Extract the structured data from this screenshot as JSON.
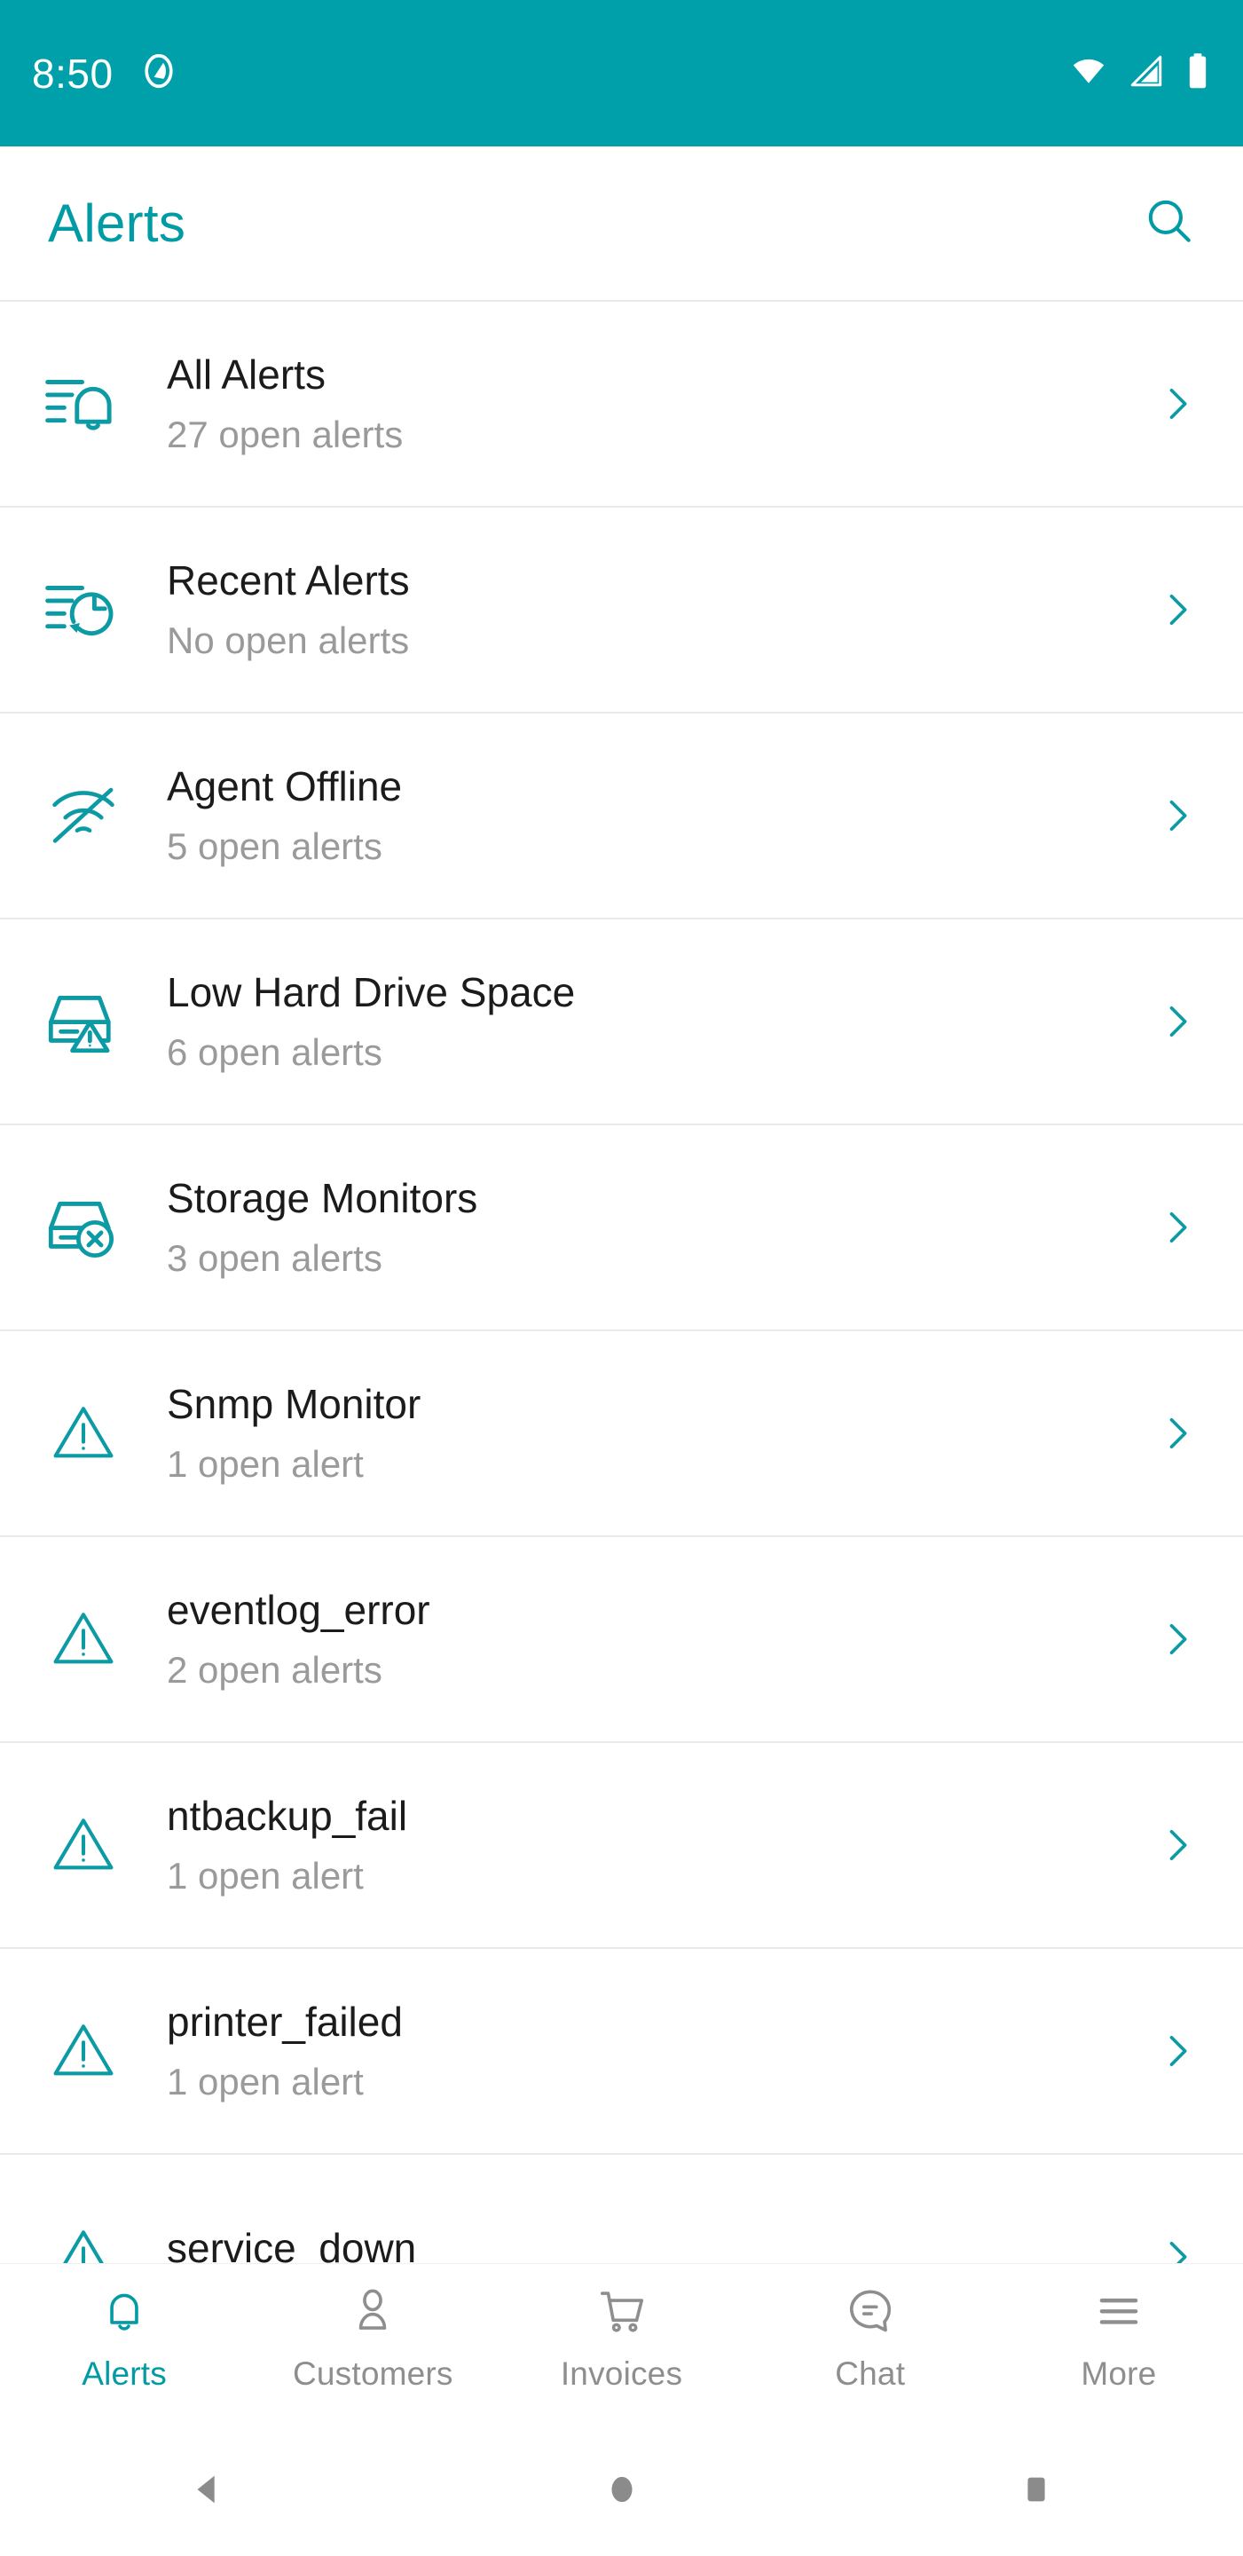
{
  "statusbar": {
    "time": "8:50",
    "icons": [
      "android-q-logo-icon",
      "wifi-icon",
      "cellular-signal-icon",
      "battery-icon"
    ]
  },
  "header": {
    "title": "Alerts",
    "search_icon": "search-icon"
  },
  "colors": {
    "accent": "#009BA5",
    "statusbar": "#00A0AA",
    "title": "#1b1b1b",
    "subtitle": "#9a9a9a",
    "divider": "#eaeaea",
    "inactive_tab": "#8e8e8e"
  },
  "list": {
    "items": [
      {
        "title": "All Alerts",
        "subtitle": "27 open alerts",
        "icon": "alert-list-bell-icon",
        "chevron": "chevron-right-icon"
      },
      {
        "title": "Recent Alerts",
        "subtitle": "No open alerts",
        "icon": "alert-list-history-icon",
        "chevron": "chevron-right-icon"
      },
      {
        "title": "Agent Offline",
        "subtitle": "5 open alerts",
        "icon": "wifi-off-icon",
        "chevron": "chevron-right-icon"
      },
      {
        "title": "Low Hard Drive Space",
        "subtitle": "6 open alerts",
        "icon": "hard-drive-warning-icon",
        "chevron": "chevron-right-icon"
      },
      {
        "title": "Storage Monitors",
        "subtitle": "3 open alerts",
        "icon": "hard-drive-error-icon",
        "chevron": "chevron-right-icon"
      },
      {
        "title": "Snmp Monitor",
        "subtitle": "1 open alert",
        "icon": "warning-triangle-icon",
        "chevron": "chevron-right-icon"
      },
      {
        "title": "eventlog_error",
        "subtitle": "2 open alerts",
        "icon": "warning-triangle-icon",
        "chevron": "chevron-right-icon"
      },
      {
        "title": "ntbackup_fail",
        "subtitle": "1 open alert",
        "icon": "warning-triangle-icon",
        "chevron": "chevron-right-icon"
      },
      {
        "title": "printer_failed",
        "subtitle": "1 open alert",
        "icon": "warning-triangle-icon",
        "chevron": "chevron-right-icon"
      },
      {
        "title": "service_down",
        "subtitle": "",
        "icon": "warning-triangle-icon",
        "chevron": "chevron-right-icon"
      }
    ]
  },
  "tabbar": {
    "tabs": [
      {
        "label": "Alerts",
        "icon": "bell-icon",
        "active": true
      },
      {
        "label": "Customers",
        "icon": "person-icon",
        "active": false
      },
      {
        "label": "Invoices",
        "icon": "shopping-cart-icon",
        "active": false
      },
      {
        "label": "Chat",
        "icon": "chat-bubble-icon",
        "active": false
      },
      {
        "label": "More",
        "icon": "hamburger-menu-icon",
        "active": false
      }
    ]
  },
  "navbar": {
    "buttons": [
      {
        "name": "back-button",
        "icon": "triangle-back-icon"
      },
      {
        "name": "home-button",
        "icon": "circle-home-icon"
      },
      {
        "name": "recents-button",
        "icon": "square-recents-icon"
      }
    ]
  }
}
